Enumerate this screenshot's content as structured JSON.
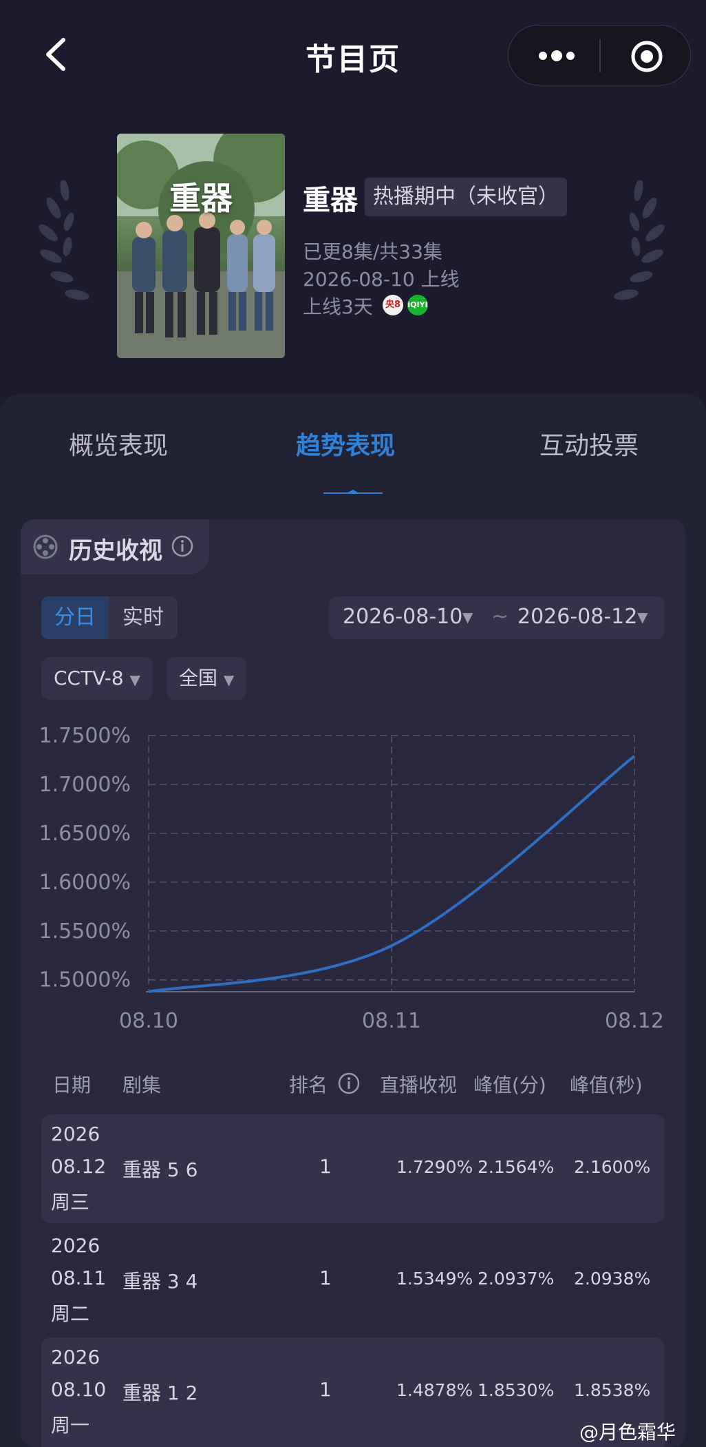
{
  "header": {
    "title": "节目页"
  },
  "show": {
    "poster_title": "重器",
    "name": "重器",
    "status": "热播期中（未收官）",
    "episodes": "已更8集/共33集",
    "premiere": "2026-08-10 上线",
    "days_online": "上线3天",
    "platforms": [
      "央8",
      "iQIYI"
    ]
  },
  "tabs": [
    {
      "label": "概览表现"
    },
    {
      "label": "趋势表现"
    },
    {
      "label": "互动投票"
    }
  ],
  "section": {
    "title": "历史收视"
  },
  "mode": {
    "options": [
      "分日",
      "实时"
    ],
    "selected": "分日"
  },
  "date_range": {
    "start": "2026-08-10",
    "separator": "~",
    "end": "2026-08-12"
  },
  "filters": {
    "channel": "CCTV-8",
    "region": "全国"
  },
  "chart_data": {
    "type": "line",
    "categories": [
      "08.10",
      "08.11",
      "08.12"
    ],
    "yticks": [
      "1.7500%",
      "1.7000%",
      "1.6500%",
      "1.6000%",
      "1.5500%",
      "1.5000%"
    ],
    "ylim": [
      1.4878,
      1.75
    ],
    "series": [
      {
        "values": [
          1.4878,
          1.5349,
          1.729
        ],
        "color": "#2f6ec4"
      }
    ],
    "grid": true
  },
  "table": {
    "headers": [
      "日期",
      "剧集",
      "排名",
      "直播收视",
      "峰值(分)",
      "峰值(秒)"
    ],
    "rows": [
      {
        "year": "2026",
        "date": "08.12",
        "weekday": "周三",
        "episode": "重器 5 6",
        "rank": "1",
        "rating": "1.7290%",
        "peak_min": "2.1564%",
        "peak_sec": "2.1600%"
      },
      {
        "year": "2026",
        "date": "08.11",
        "weekday": "周二",
        "episode": "重器 3 4",
        "rank": "1",
        "rating": "1.5349%",
        "peak_min": "2.0937%",
        "peak_sec": "2.0938%"
      },
      {
        "year": "2026",
        "date": "08.10",
        "weekday": "周一",
        "episode": "重器 1 2",
        "rank": "1",
        "rating": "1.4878%",
        "peak_min": "1.8530%",
        "peak_sec": "1.8538%"
      }
    ]
  },
  "watermark": "@月色霜华",
  "colors": {
    "accent": "#2f82d9",
    "background": "#1c1b2e",
    "panel": "#222235"
  }
}
